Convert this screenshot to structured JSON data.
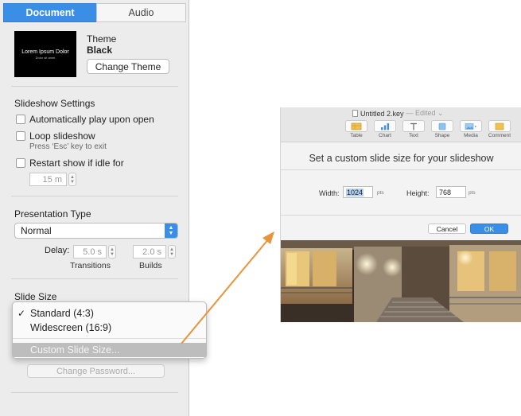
{
  "inspector": {
    "tabs": [
      {
        "label": "Document",
        "active": true
      },
      {
        "label": "Audio",
        "active": false
      }
    ],
    "theme": {
      "thumb_title": "Lorem Ipsum Dolor",
      "thumb_sub": "Dolor sit amet",
      "label": "Theme",
      "name": "Black",
      "change_button": "Change Theme"
    },
    "slideshow": {
      "header": "Slideshow Settings",
      "auto_play": {
        "label": "Automatically play upon open",
        "checked": false
      },
      "loop": {
        "label": "Loop slideshow",
        "checked": false,
        "note": "Press ‘Esc’ key to exit"
      },
      "restart": {
        "label": "Restart show if idle for",
        "checked": false,
        "value": "15 m"
      }
    },
    "presentation": {
      "header": "Presentation Type",
      "selected": "Normal",
      "delay_label": "Delay:",
      "transitions_value": "5.0 s",
      "transitions_label": "Transitions",
      "builds_value": "2.0 s",
      "builds_label": "Builds"
    },
    "slide_size": {
      "header": "Slide Size",
      "options": [
        {
          "label": "Standard (4:3)",
          "checked": true
        },
        {
          "label": "Widescreen (16:9)",
          "checked": false
        }
      ],
      "custom_label": "Custom Slide Size..."
    },
    "change_password": "Change Password..."
  },
  "colors": {
    "accent": "#3a8ee6",
    "annotation_arrow": "#e8943a",
    "panel_bg": "#ececec"
  },
  "keynote": {
    "title": "Untitled 2.key",
    "edited": "— Edited ⌄",
    "toolbar": [
      {
        "label": "Table",
        "icon": "table-icon"
      },
      {
        "label": "Chart",
        "icon": "chart-icon"
      },
      {
        "label": "Text",
        "icon": "text-icon"
      },
      {
        "label": "Shape",
        "icon": "shape-icon"
      },
      {
        "label": "Media",
        "icon": "media-icon"
      },
      {
        "label": "Comment",
        "icon": "comment-icon"
      }
    ],
    "dialog": {
      "title": "Set a custom slide size for your slideshow",
      "width_label": "Width:",
      "width_value": "1024",
      "height_label": "Height:",
      "height_value": "768",
      "unit": "pts",
      "cancel": "Cancel",
      "ok": "OK"
    }
  }
}
